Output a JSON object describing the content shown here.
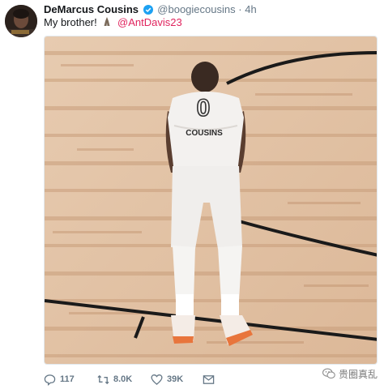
{
  "tweet": {
    "author_name": "DeMarcus Cousins",
    "handle": "@boogiecousins",
    "separator": "·",
    "timestamp": "4h",
    "text_prefix": "My brother!",
    "mention": "@AntDavis23",
    "emoji_icon": "praying-hands-icon",
    "verified_icon": "verified-badge-icon",
    "mention_color": "#e0245e"
  },
  "photo": {
    "jersey_number": "0",
    "jersey_name": "COUSINS"
  },
  "actions": {
    "replies": "117",
    "retweets": "8.0K",
    "likes": "39K",
    "reply_icon": "reply-icon",
    "retweet_icon": "retweet-icon",
    "like_icon": "heart-icon",
    "dm_icon": "envelope-icon"
  },
  "watermark": {
    "text": "贵圈真乱",
    "icon": "wechat-icon"
  }
}
